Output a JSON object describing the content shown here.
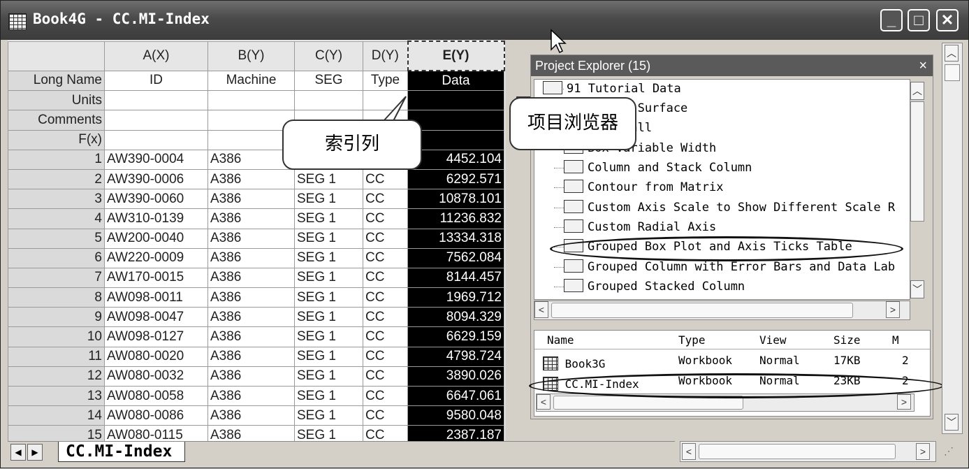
{
  "window": {
    "title": "Book4G - CC.MI-Index"
  },
  "grid": {
    "columns": [
      {
        "header": "A(X)",
        "long_name": "ID"
      },
      {
        "header": "B(Y)",
        "long_name": "Machine"
      },
      {
        "header": "C(Y)",
        "long_name": "SEG"
      },
      {
        "header": "D(Y)",
        "long_name": "Type"
      },
      {
        "header": "E(Y)",
        "long_name": "Data"
      }
    ],
    "label_rows": [
      "Long Name",
      "Units",
      "Comments",
      "F(x)"
    ],
    "rows": [
      {
        "n": "1",
        "id": "AW390-0004",
        "machine": "A386",
        "seg": "",
        "type": "",
        "data": "4452.104"
      },
      {
        "n": "2",
        "id": "AW390-0006",
        "machine": "A386",
        "seg": "SEG 1",
        "type": "CC",
        "data": "6292.571"
      },
      {
        "n": "3",
        "id": "AW390-0060",
        "machine": "A386",
        "seg": "SEG 1",
        "type": "CC",
        "data": "10878.101"
      },
      {
        "n": "4",
        "id": "AW310-0139",
        "machine": "A386",
        "seg": "SEG 1",
        "type": "CC",
        "data": "11236.832"
      },
      {
        "n": "5",
        "id": "AW200-0040",
        "machine": "A386",
        "seg": "SEG 1",
        "type": "CC",
        "data": "13334.318"
      },
      {
        "n": "6",
        "id": "AW220-0009",
        "machine": "A386",
        "seg": "SEG 1",
        "type": "CC",
        "data": "7562.084"
      },
      {
        "n": "7",
        "id": "AW170-0015",
        "machine": "A386",
        "seg": "SEG 1",
        "type": "CC",
        "data": "8144.457"
      },
      {
        "n": "8",
        "id": "AW098-0011",
        "machine": "A386",
        "seg": "SEG 1",
        "type": "CC",
        "data": "1969.712"
      },
      {
        "n": "9",
        "id": "AW098-0047",
        "machine": "A386",
        "seg": "SEG 1",
        "type": "CC",
        "data": "8094.329"
      },
      {
        "n": "10",
        "id": "AW098-0127",
        "machine": "A386",
        "seg": "SEG 1",
        "type": "CC",
        "data": "6629.159"
      },
      {
        "n": "11",
        "id": "AW080-0020",
        "machine": "A386",
        "seg": "SEG 1",
        "type": "CC",
        "data": "4798.724"
      },
      {
        "n": "12",
        "id": "AW080-0032",
        "machine": "A386",
        "seg": "SEG 1",
        "type": "CC",
        "data": "3890.026"
      },
      {
        "n": "13",
        "id": "AW080-0058",
        "machine": "A386",
        "seg": "SEG 1",
        "type": "CC",
        "data": "6647.061"
      },
      {
        "n": "14",
        "id": "AW080-0086",
        "machine": "A386",
        "seg": "SEG 1",
        "type": "CC",
        "data": "9580.048"
      },
      {
        "n": "15",
        "id": "AW080-0115",
        "machine": "A386",
        "seg": "SEG 1",
        "type": "CC",
        "data": "2387.187"
      }
    ]
  },
  "sheet_tab": "CC.MI-Index",
  "callouts": {
    "index_column": "索引列",
    "project_explorer": "项目浏览器"
  },
  "project_explorer": {
    "title": "Project Explorer (15)",
    "close": "×",
    "tree": [
      "91 Tutorial Data",
      "Binary Surface",
      "Waterfall",
      "Box Variable Width",
      "Column and Stack Column",
      "Contour from Matrix",
      "Custom Axis Scale to Show Different Scale R",
      "Custom Radial Axis",
      "Grouped Box Plot and Axis Ticks Table",
      "Grouped Column with Error Bars and Data Lab",
      "Grouped Stacked Column"
    ],
    "list_headers": [
      "Name",
      "Type",
      "View",
      "Size",
      "M"
    ],
    "list_rows": [
      {
        "name": "Book3G",
        "type": "Workbook",
        "view": "Normal",
        "size": "17KB",
        "m": "2"
      },
      {
        "name": "CC.MI-Index",
        "type": "Workbook",
        "view": "Normal",
        "size": "23KB",
        "m": "2"
      }
    ]
  }
}
